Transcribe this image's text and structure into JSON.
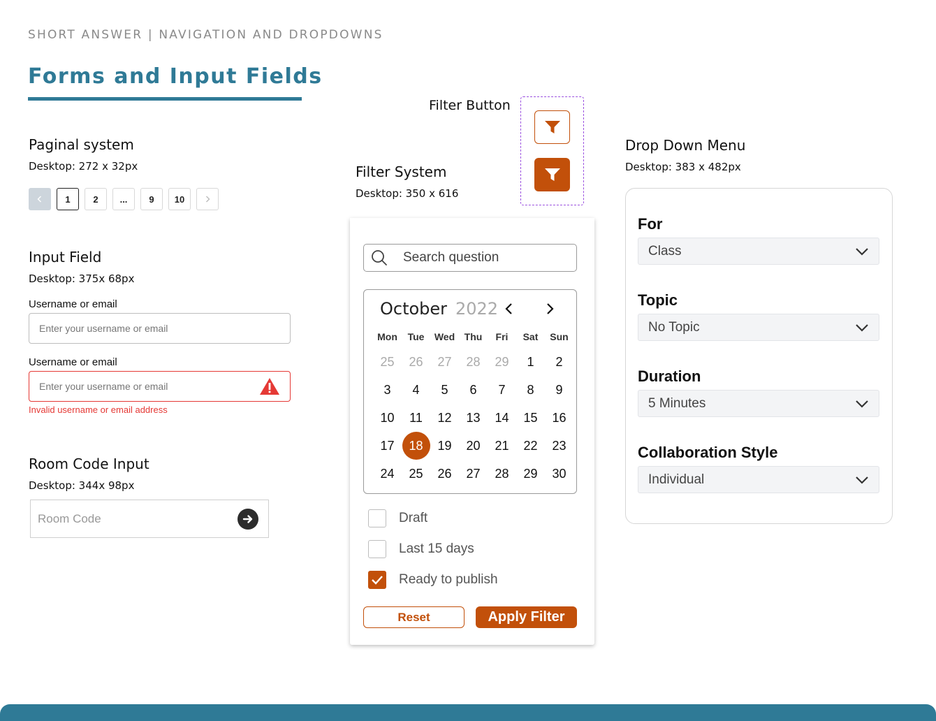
{
  "header": {
    "eyebrow": "SHORT ANSWER | NAVIGATION AND DROPDOWNS",
    "title": "Forms and Input Fields"
  },
  "pagination": {
    "title": "Paginal system",
    "size": "Desktop: 272 x 32px",
    "pages": [
      "1",
      "2",
      "...",
      "9",
      "10"
    ],
    "active_page": "1"
  },
  "input_field": {
    "title": "Input Field",
    "size": "Desktop: 375x 68px",
    "normal": {
      "label": "Username or email",
      "placeholder": "Enter your username or email"
    },
    "error": {
      "label": "Username or email",
      "placeholder": "Enter your username or email",
      "message": "Invalid username or email address"
    }
  },
  "room_code": {
    "title": "Room Code Input",
    "size": "Desktop: 344x 98px",
    "placeholder": "Room Code"
  },
  "filter_button": {
    "title": "Filter Button"
  },
  "filter_system": {
    "title": "Filter System",
    "size": "Desktop: 350 x 616",
    "search_placeholder": "Search question",
    "calendar": {
      "month": "October",
      "year": "2022",
      "weekdays": [
        "Mon",
        "Tue",
        "Wed",
        "Thu",
        "Fri",
        "Sat",
        "Sun"
      ],
      "days": [
        [
          "25",
          "26",
          "27",
          "28",
          "29",
          "1",
          "2"
        ],
        [
          "3",
          "4",
          "5",
          "6",
          "7",
          "8",
          "9"
        ],
        [
          "10",
          "11",
          "12",
          "13",
          "14",
          "15",
          "16"
        ],
        [
          "17",
          "18",
          "19",
          "20",
          "21",
          "22",
          "23"
        ],
        [
          "24",
          "25",
          "26",
          "27",
          "28",
          "29",
          "30"
        ]
      ],
      "selected_day": "18"
    },
    "checkboxes": [
      {
        "label": "Draft",
        "checked": false
      },
      {
        "label": "Last 15 days",
        "checked": false
      },
      {
        "label": "Ready to publish",
        "checked": true
      }
    ],
    "reset_label": "Reset",
    "apply_label": "Apply Filter"
  },
  "dropdown_menu": {
    "title": "Drop Down Menu",
    "size": "Desktop: 383 x 482px",
    "fields": [
      {
        "label": "For",
        "value": "Class"
      },
      {
        "label": "Topic",
        "value": "No Topic"
      },
      {
        "label": "Duration",
        "value": "5 Minutes"
      },
      {
        "label": "Collaboration Style",
        "value": "Individual"
      }
    ]
  },
  "colors": {
    "accent": "#c2500a",
    "heading": "#2f7a96",
    "error": "#e53935"
  }
}
